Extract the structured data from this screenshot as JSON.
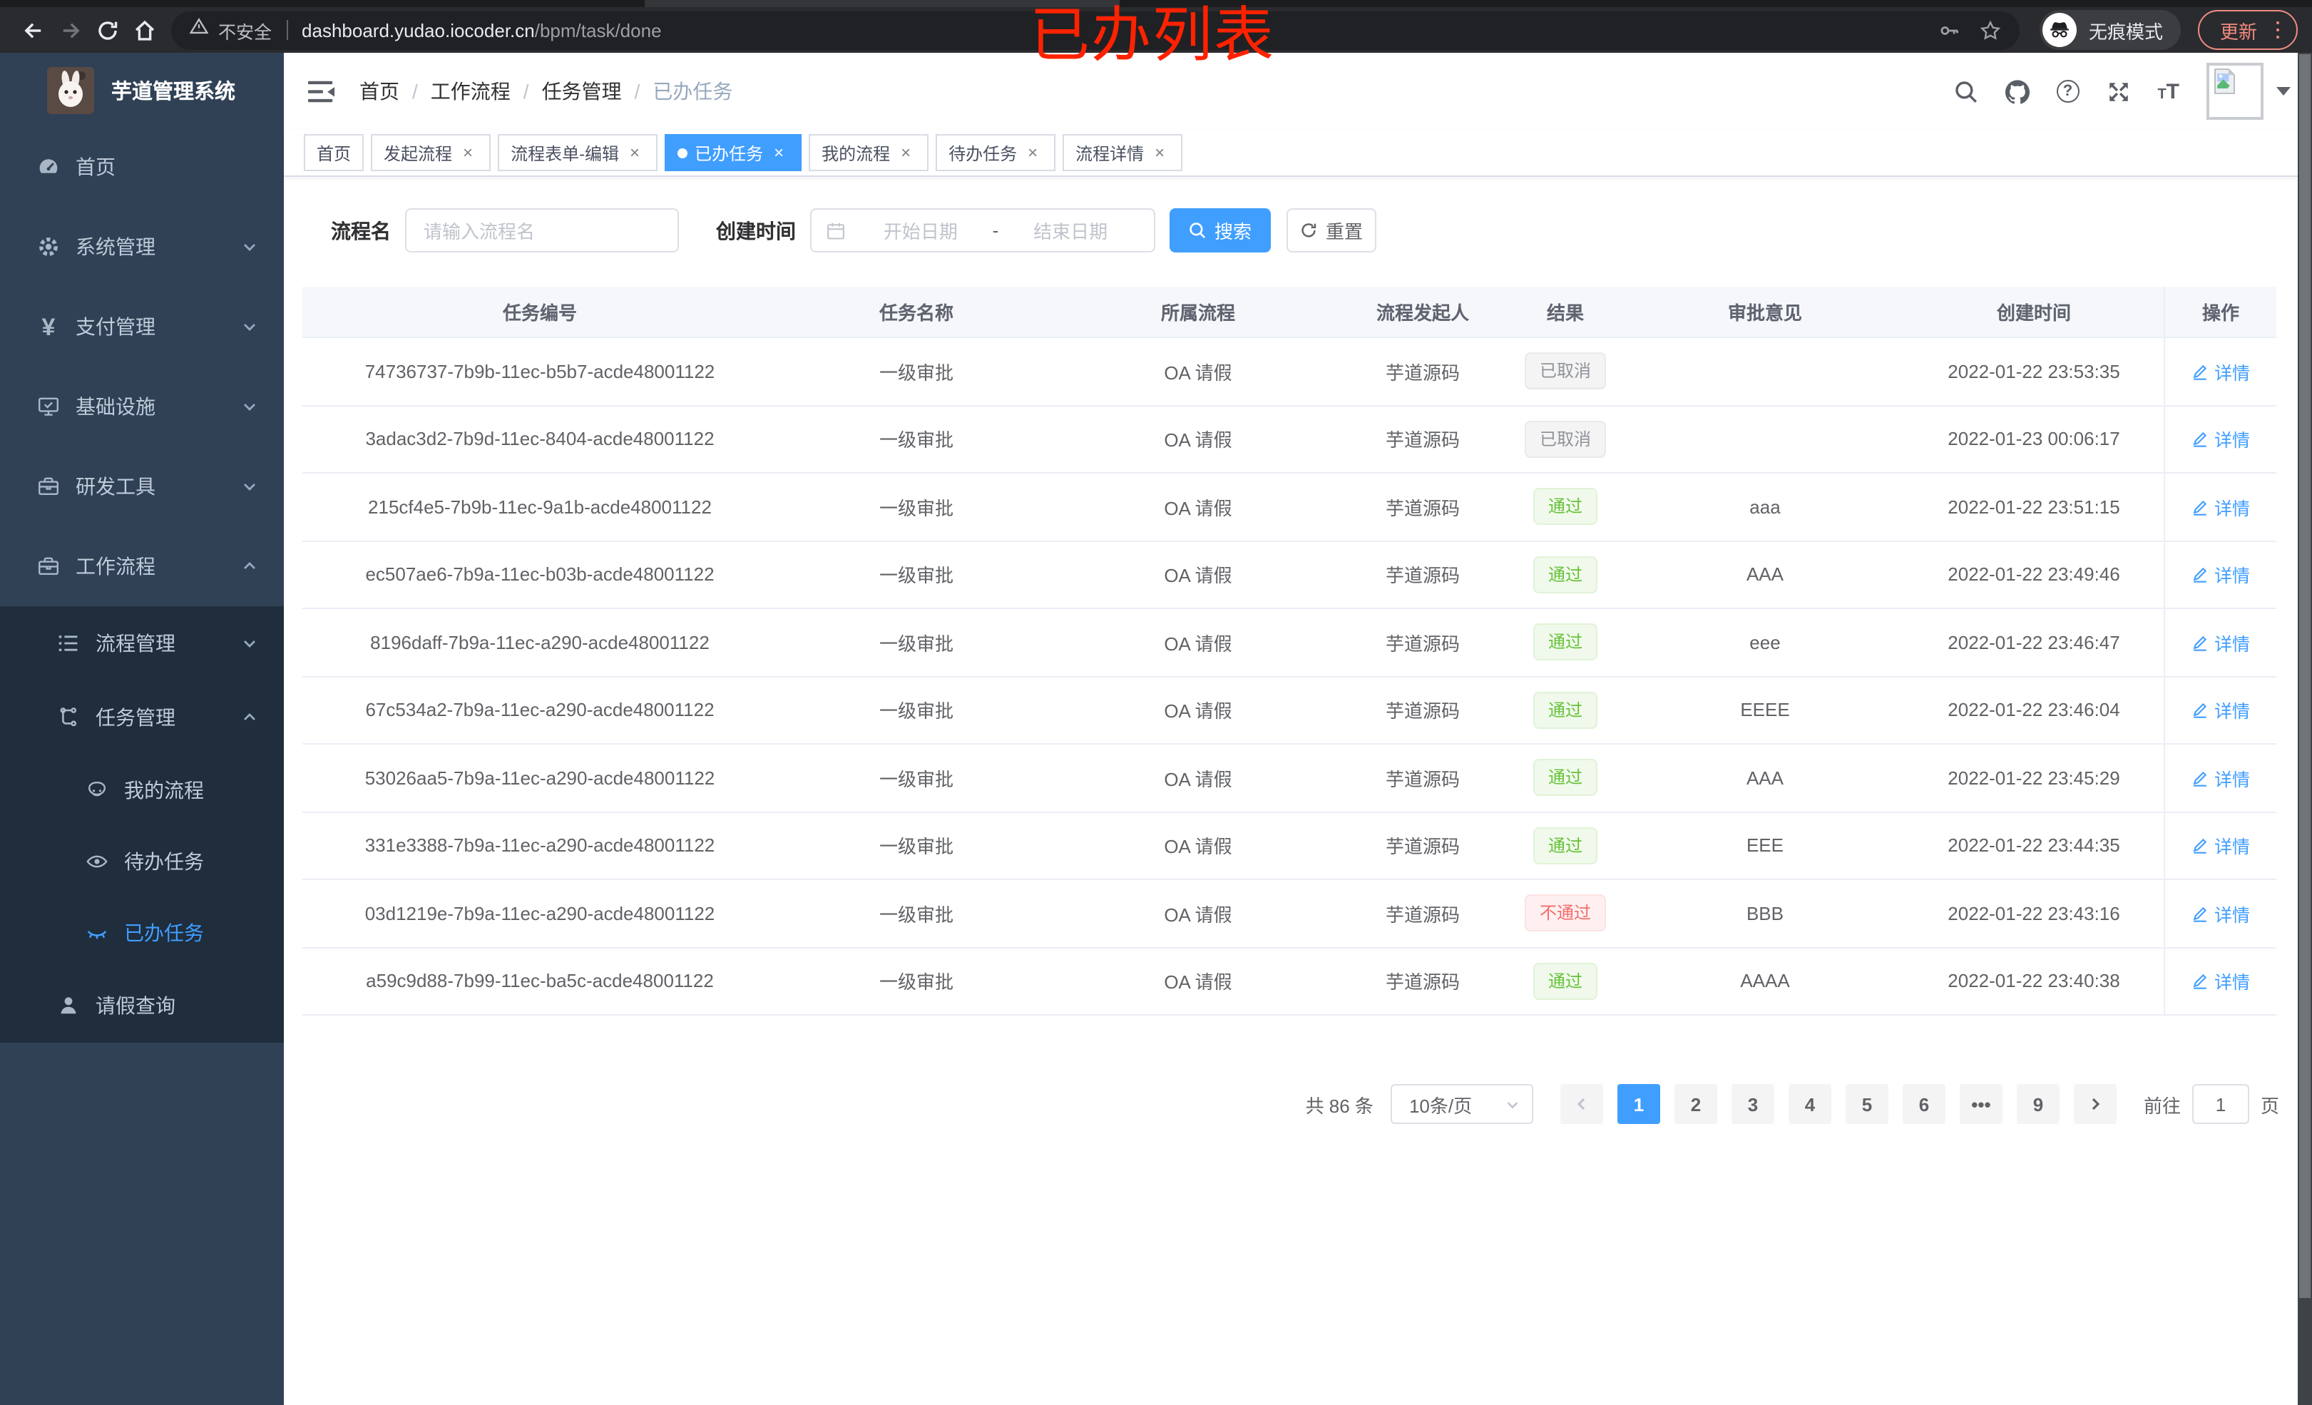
{
  "colors": {
    "accent": "#409eff",
    "success": "#67c23a",
    "danger": "#f56c6c",
    "info": "#909399",
    "sidebar_bg": "#304156",
    "submenu_bg": "#1f2d3d"
  },
  "browser": {
    "security_label": "不安全",
    "url_host": "dashboard.yudao.iocoder.cn",
    "url_path": "/bpm/task/done",
    "incognito_label": "无痕模式",
    "update_label": "更新",
    "annotation": "已办列表"
  },
  "sidebar": {
    "logo_title": "芋道管理系统",
    "items": [
      {
        "label": "首页",
        "icon": "dashboard-icon",
        "level": 1
      },
      {
        "label": "系统管理",
        "icon": "gear-icon",
        "level": 1,
        "chevron": "down"
      },
      {
        "label": "支付管理",
        "icon": "yen-icon",
        "level": 1,
        "chevron": "down"
      },
      {
        "label": "基础设施",
        "icon": "monitor-icon",
        "level": 1,
        "chevron": "down"
      },
      {
        "label": "研发工具",
        "icon": "toolbox-icon",
        "level": 1,
        "chevron": "down"
      },
      {
        "label": "工作流程",
        "icon": "briefcase-icon",
        "level": 1,
        "chevron": "up"
      },
      {
        "label": "流程管理",
        "icon": "list-tree-icon",
        "level": 2,
        "chevron": "down",
        "sub": true
      },
      {
        "label": "任务管理",
        "icon": "flow-tree-icon",
        "level": 2,
        "chevron": "up",
        "sub": true
      },
      {
        "label": "我的流程",
        "icon": "face-icon",
        "level": 3,
        "sub": true
      },
      {
        "label": "待办任务",
        "icon": "eye-open-icon",
        "level": 3,
        "sub": true
      },
      {
        "label": "已办任务",
        "icon": "eye-closed-icon",
        "level": 3,
        "sub": true,
        "active": true
      },
      {
        "label": "请假查询",
        "icon": "user-icon",
        "level": 2,
        "sub": true
      }
    ]
  },
  "navbar": {
    "breadcrumb": [
      "首页",
      "工作流程",
      "任务管理",
      "已办任务"
    ]
  },
  "tabs": [
    {
      "label": "首页",
      "closable": false,
      "active": false
    },
    {
      "label": "发起流程",
      "closable": true,
      "active": false
    },
    {
      "label": "流程表单-编辑",
      "closable": true,
      "active": false
    },
    {
      "label": "已办任务",
      "closable": true,
      "active": true
    },
    {
      "label": "我的流程",
      "closable": true,
      "active": false
    },
    {
      "label": "待办任务",
      "closable": true,
      "active": false
    },
    {
      "label": "流程详情",
      "closable": true,
      "active": false
    }
  ],
  "filter": {
    "name_label": "流程名",
    "name_placeholder": "请输入流程名",
    "time_label": "创建时间",
    "start_placeholder": "开始日期",
    "range_separator": "-",
    "end_placeholder": "结束日期",
    "search_label": "搜索",
    "reset_label": "重置"
  },
  "table": {
    "headers": [
      "任务编号",
      "任务名称",
      "所属流程",
      "流程发起人",
      "结果",
      "审批意见",
      "创建时间",
      "操作"
    ],
    "action_label": "详情",
    "rows": [
      {
        "id": "74736737-7b9b-11ec-b5b7-acde48001122",
        "name": "一级审批",
        "flow": "OA 请假",
        "initiator": "芋道源码",
        "result": "已取消",
        "result_type": "info",
        "comment": "",
        "time": "2022-01-22 23:53:35"
      },
      {
        "id": "3adac3d2-7b9d-11ec-8404-acde48001122",
        "name": "一级审批",
        "flow": "OA 请假",
        "initiator": "芋道源码",
        "result": "已取消",
        "result_type": "info",
        "comment": "",
        "time": "2022-01-23 00:06:17"
      },
      {
        "id": "215cf4e5-7b9b-11ec-9a1b-acde48001122",
        "name": "一级审批",
        "flow": "OA 请假",
        "initiator": "芋道源码",
        "result": "通过",
        "result_type": "success",
        "comment": "aaa",
        "time": "2022-01-22 23:51:15"
      },
      {
        "id": "ec507ae6-7b9a-11ec-b03b-acde48001122",
        "name": "一级审批",
        "flow": "OA 请假",
        "initiator": "芋道源码",
        "result": "通过",
        "result_type": "success",
        "comment": "AAA",
        "time": "2022-01-22 23:49:46"
      },
      {
        "id": "8196daff-7b9a-11ec-a290-acde48001122",
        "name": "一级审批",
        "flow": "OA 请假",
        "initiator": "芋道源码",
        "result": "通过",
        "result_type": "success",
        "comment": "eee",
        "time": "2022-01-22 23:46:47"
      },
      {
        "id": "67c534a2-7b9a-11ec-a290-acde48001122",
        "name": "一级审批",
        "flow": "OA 请假",
        "initiator": "芋道源码",
        "result": "通过",
        "result_type": "success",
        "comment": "EEEE",
        "time": "2022-01-22 23:46:04"
      },
      {
        "id": "53026aa5-7b9a-11ec-a290-acde48001122",
        "name": "一级审批",
        "flow": "OA 请假",
        "initiator": "芋道源码",
        "result": "通过",
        "result_type": "success",
        "comment": "AAA",
        "time": "2022-01-22 23:45:29"
      },
      {
        "id": "331e3388-7b9a-11ec-a290-acde48001122",
        "name": "一级审批",
        "flow": "OA 请假",
        "initiator": "芋道源码",
        "result": "通过",
        "result_type": "success",
        "comment": "EEE",
        "time": "2022-01-22 23:44:35"
      },
      {
        "id": "03d1219e-7b9a-11ec-a290-acde48001122",
        "name": "一级审批",
        "flow": "OA 请假",
        "initiator": "芋道源码",
        "result": "不通过",
        "result_type": "danger",
        "comment": "BBB",
        "time": "2022-01-22 23:43:16"
      },
      {
        "id": "a59c9d88-7b99-11ec-ba5c-acde48001122",
        "name": "一级审批",
        "flow": "OA 请假",
        "initiator": "芋道源码",
        "result": "通过",
        "result_type": "success",
        "comment": "AAAA",
        "time": "2022-01-22 23:40:38"
      }
    ]
  },
  "pagination": {
    "total_label": "共 86 条",
    "page_size_label": "10条/页",
    "pages": [
      "1",
      "2",
      "3",
      "4",
      "5",
      "6",
      "•••",
      "9"
    ],
    "active_page": "1",
    "goto_label": "前往",
    "goto_value": "1",
    "goto_unit": "页"
  }
}
